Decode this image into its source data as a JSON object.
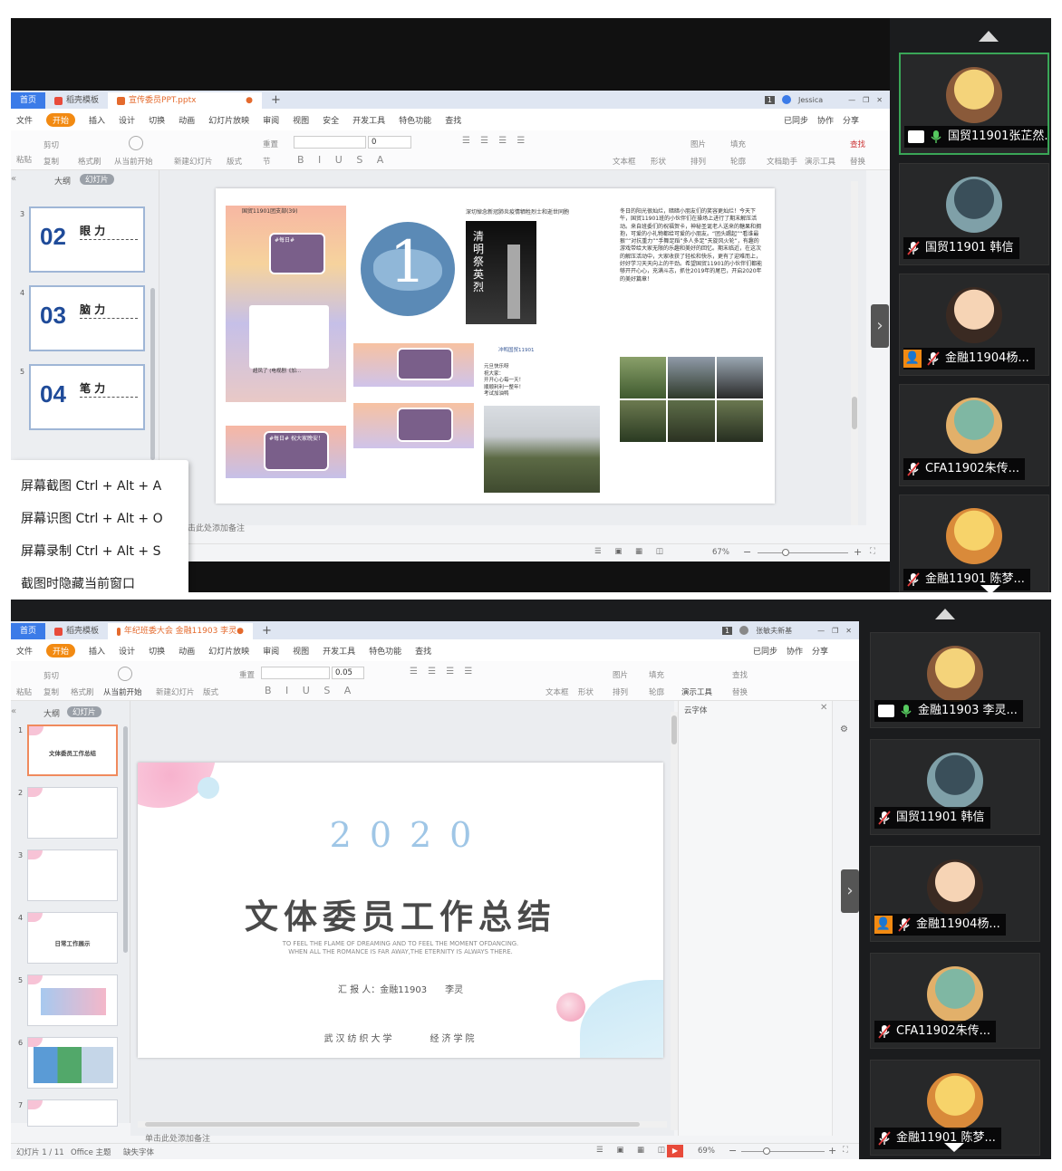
{
  "top": {
    "tabs": {
      "home": "首页",
      "template": "稻壳模板",
      "file": "宣传委员PPT.pptx"
    },
    "user": "Jessica",
    "menu": [
      "文件",
      "开始",
      "插入",
      "设计",
      "切换",
      "动画",
      "幻灯片放映",
      "审阅",
      "视图",
      "安全",
      "开发工具",
      "特色功能",
      "查找"
    ],
    "menu_right": [
      "已同步",
      "协作",
      "分享"
    ],
    "toolbar": {
      "paste": "粘贴",
      "cut": "剪切",
      "copy": "复制",
      "format": "格式刷",
      "play": "从当前开始",
      "new_slide": "新建幻灯片",
      "layout": "版式",
      "reset": "重置",
      "section": "节",
      "font_size": "0",
      "textbox": "文本框",
      "shape": "形状",
      "picture": "图片",
      "fill": "填充",
      "arrange": "排列",
      "outline": "轮廓",
      "writer": "文档助手",
      "presenter": "演示工具",
      "find": "查找",
      "replace": "替换"
    },
    "side_tabs": [
      "大纲",
      "幻灯片"
    ],
    "thumbs": [
      {
        "num": "3",
        "big": "02",
        "title": "眼 力"
      },
      {
        "num": "4",
        "big": "03",
        "title": "脑 力"
      },
      {
        "num": "5",
        "big": "04",
        "title": "笔 力"
      }
    ],
    "note": "单击此处添加备注",
    "zoom": "67%",
    "context_menu": [
      "屏幕截图 Ctrl + Alt + A",
      "屏幕识图 Ctrl + Alt + O",
      "屏幕录制 Ctrl + Alt + S",
      "截图时隐藏当前窗口"
    ],
    "slide": {
      "chat_header": "国贸11901团支部(39)",
      "chat_bubbles": [
        "#每日#",
        "#每日# 祝大家晚安！"
      ],
      "chat_share": "超凤了 (电视剧《加...",
      "badge_number": "1",
      "memorial_caption": "深切悼念新冠肺炎疫情牺牲烈士和逝世同胞",
      "memorial_poem": "清明祭英烈",
      "moment_name": "冲鸭国贸11901",
      "moment_lines": [
        "元旦快乐呀",
        "祝大家：",
        "开开心心每一天！",
        "顺顺利利一整年！",
        "考试加油鸭"
      ],
      "story": "冬日的阳光很灿烂，暗暗小朋友们的笑容更灿烂！今天下午，国贸11901班的小伙伴们在操场上进行了期末解压活动。来自班委们的祝福贺卡，神秘圣诞老人送来的糖果和拥抱，可爱的小礼物都给可爱的小朋友。“团头踢起”“看谁最狠”“对抗重力”“手舞足蹈”多人多足“天旋风火轮”，有趣的游戏带给大家无限的乐趣和美好的回忆。期末临近，在这次的解压活动中，大家收获了轻松和快乐，更有了迎难而上，好好学习天天向上的干劲。希望国贸11901的小伙伴们都能够开开心心，充满斗志，抓住2019年的尾巴，开启2020年的美好篇章！"
    }
  },
  "bottom": {
    "tabs": {
      "home": "首页",
      "template": "稻壳模板",
      "file": "年纪班委大会 金融11903 李灵"
    },
    "user": "张敏夫新基",
    "menu": [
      "文件",
      "开始",
      "插入",
      "设计",
      "切换",
      "动画",
      "幻灯片放映",
      "审阅",
      "视图",
      "开发工具",
      "特色功能",
      "查找"
    ],
    "menu_right": [
      "已同步",
      "协作",
      "分享"
    ],
    "font_size": "0.05",
    "side_tabs": [
      "大纲",
      "幻灯片"
    ],
    "thumb_nums": [
      "1",
      "2",
      "3",
      "4",
      "5",
      "6",
      "7"
    ],
    "thumb_texts": [
      "文体委员工作总结",
      "",
      "",
      "日常工作展示"
    ],
    "note": "单击此处添加备注",
    "status": {
      "slide": "幻灯片 1 / 11",
      "theme": "Office 主题",
      "font": "缺失字体",
      "zoom": "69%"
    },
    "task_pane_font": "云字体",
    "slide": {
      "year": "2020",
      "title": "文体委员工作总结",
      "en1": "TO FEEL THE FLAME OF DREAMING AND TO FEEL THE MOMENT OFDANCING.",
      "en2": "WHEN ALL THE ROMANCE IS FAR AWAY,THE ETERNITY IS ALWAYS THERE.",
      "reporter": "汇 报 人：金融11903　　李灵",
      "school": "武汉纺织大学　　　经济学院"
    }
  },
  "participants_top": [
    {
      "name": "国贸11901张芷然...",
      "mic": "on",
      "share": true,
      "active": true
    },
    {
      "name": "国贸11901 韩信",
      "mic": "off"
    },
    {
      "name": "金融11904杨...",
      "mic": "off",
      "host": true
    },
    {
      "name": "CFA11902朱传...",
      "mic": "off"
    },
    {
      "name": "金融11901 陈梦...",
      "mic": "off"
    }
  ],
  "participants_bottom": [
    {
      "name": "金融11903 李灵...",
      "mic": "on",
      "share": true
    },
    {
      "name": "国贸11901 韩信",
      "mic": "off"
    },
    {
      "name": "金融11904杨...",
      "mic": "off",
      "host": true
    },
    {
      "name": "CFA11902朱传...",
      "mic": "off"
    },
    {
      "name": "金融11901 陈梦...",
      "mic": "off"
    }
  ],
  "colors": {
    "accent": "#3b7be8",
    "orange": "#f28a12",
    "active_border": "#3aa657",
    "mic_off": "#e03b3b"
  }
}
